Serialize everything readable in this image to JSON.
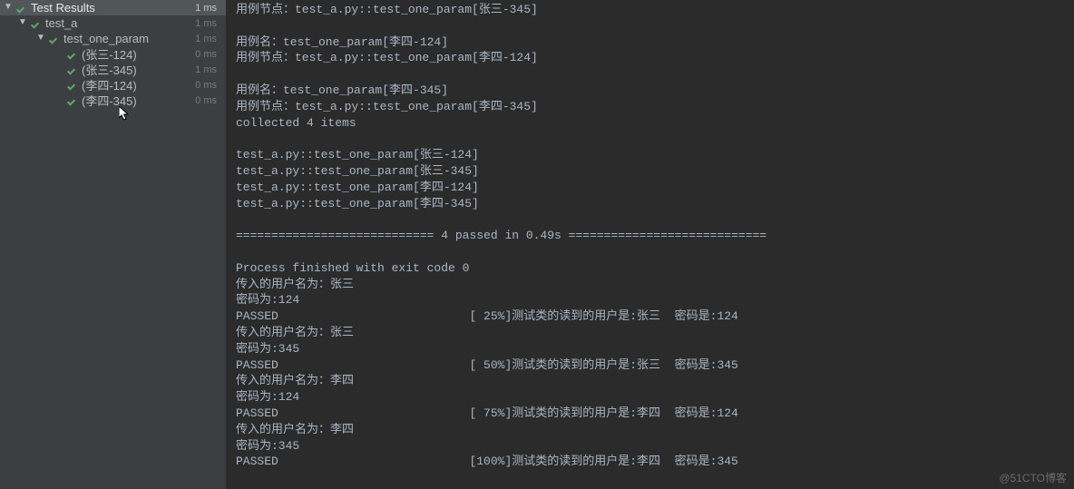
{
  "tree": {
    "root": {
      "label": "Test Results",
      "duration": "1 ms"
    },
    "suite": {
      "label": "test_a",
      "duration": "1 ms"
    },
    "fn": {
      "label": "test_one_param",
      "duration": "1 ms"
    },
    "params": [
      {
        "label": "(张三-124)",
        "duration": "0 ms"
      },
      {
        "label": "(张三-345)",
        "duration": "1 ms"
      },
      {
        "label": "(李四-124)",
        "duration": "0 ms"
      },
      {
        "label": "(李四-345)",
        "duration": "0 ms"
      }
    ]
  },
  "console": "用例节点：test_a.py::test_one_param[张三-345]\n\n用例名：test_one_param[李四-124]\n用例节点：test_a.py::test_one_param[李四-124]\n\n用例名：test_one_param[李四-345]\n用例节点：test_a.py::test_one_param[李四-345]\ncollected 4 items\n\ntest_a.py::test_one_param[张三-124]\ntest_a.py::test_one_param[张三-345]\ntest_a.py::test_one_param[李四-124]\ntest_a.py::test_one_param[李四-345]\n\n============================ 4 passed in 0.49s ============================\n\nProcess finished with exit code 0\n传入的用户名为：张三\n密码为:124\nPASSED                           [ 25%]测试类的读到的用户是:张三  密码是:124\n传入的用户名为：张三\n密码为:345\nPASSED                           [ 50%]测试类的读到的用户是:张三  密码是:345\n传入的用户名为：李四\n密码为:124\nPASSED                           [ 75%]测试类的读到的用户是:李四  密码是:124\n传入的用户名为：李四\n密码为:345\nPASSED                           [100%]测试类的读到的用户是:李四  密码是:345",
  "watermark": "@51CTO博客"
}
